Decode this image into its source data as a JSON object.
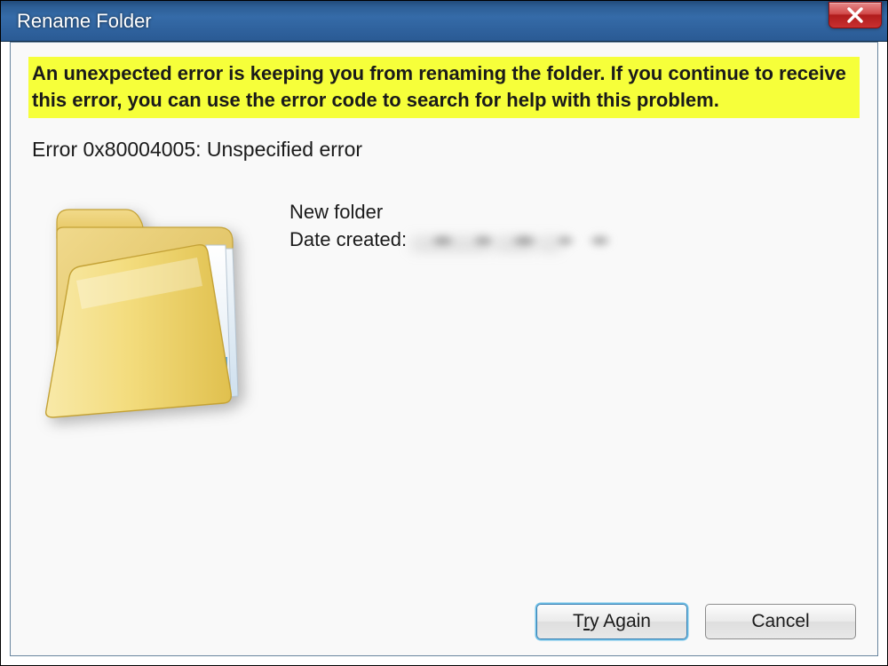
{
  "window": {
    "title": "Rename Folder"
  },
  "message": {
    "highlight": "An unexpected error is keeping you from renaming the folder. If you continue to receive this error, you can use the error code to search for help with this problem.",
    "error_code_line": "Error 0x80004005: Unspecified error"
  },
  "details": {
    "folder_name": "New folder",
    "date_created_label": "Date created:"
  },
  "buttons": {
    "try_again_pre": "T",
    "try_again_hot": "r",
    "try_again_post": "y Again",
    "cancel": "Cancel"
  },
  "icons": {
    "close": "close-icon",
    "folder": "folder-icon"
  }
}
